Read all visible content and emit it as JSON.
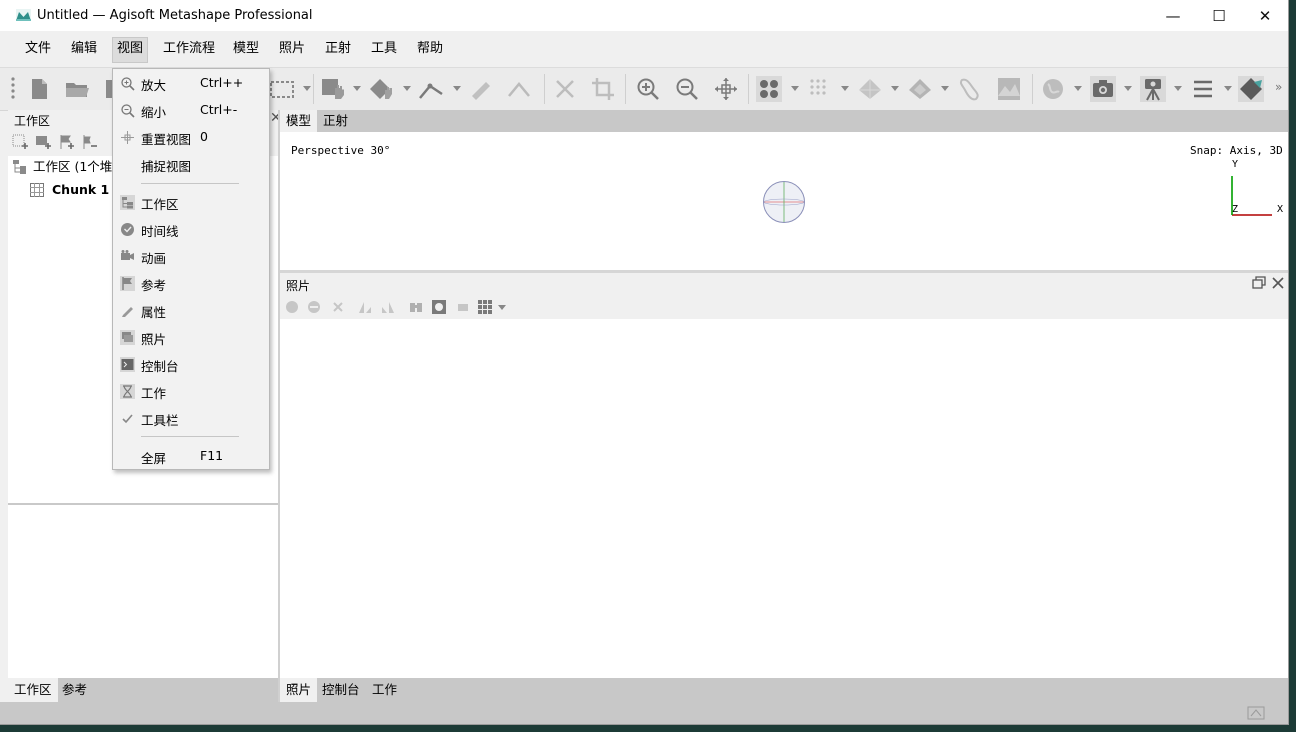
{
  "window": {
    "title": "Untitled — Agisoft Metashape Professional",
    "minimize_glyph": "—",
    "maximize_glyph": "☐",
    "close_glyph": "✕"
  },
  "menubar": {
    "items": [
      "文件",
      "编辑",
      "视图",
      "工作流程",
      "模型",
      "照片",
      "正射",
      "工具",
      "帮助"
    ],
    "active": "视图"
  },
  "view_menu": {
    "items": [
      {
        "label": "放大",
        "shortcut": "Ctrl++",
        "icon": "zoom-in-icon"
      },
      {
        "label": "缩小",
        "shortcut": "Ctrl+-",
        "icon": "zoom-out-icon"
      },
      {
        "label": "重置视图",
        "shortcut": "0",
        "icon": "reset-view-icon"
      },
      {
        "label": "捕捉视图",
        "shortcut": "",
        "icon": ""
      },
      {
        "label": "工作区",
        "shortcut": "",
        "icon": "workspace-icon"
      },
      {
        "label": "时间线",
        "shortcut": "",
        "icon": "timeline-icon"
      },
      {
        "label": "动画",
        "shortcut": "",
        "icon": "animation-icon"
      },
      {
        "label": "参考",
        "shortcut": "",
        "icon": "reference-icon"
      },
      {
        "label": "属性",
        "shortcut": "",
        "icon": "properties-icon"
      },
      {
        "label": "照片",
        "shortcut": "",
        "icon": "photos-icon"
      },
      {
        "label": "控制台",
        "shortcut": "",
        "icon": "console-icon"
      },
      {
        "label": "工作",
        "shortcut": "",
        "icon": "jobs-icon"
      },
      {
        "label": "工具栏",
        "shortcut": "",
        "icon": "check-icon",
        "checked": true
      },
      {
        "label": "全屏",
        "shortcut": "F11",
        "icon": ""
      }
    ]
  },
  "workspace_panel": {
    "title": "工作区",
    "root_label": "工作区 (1个堆块",
    "chunk_label": "Chunk 1",
    "bottom_tabs": [
      "工作区",
      "参考"
    ]
  },
  "model_view": {
    "tabs": [
      "模型",
      "正射"
    ],
    "projection_text": "Perspective 30°",
    "snap_text": "Snap: Axis, 3D",
    "axis_y": "Y",
    "axis_x": "X",
    "axis_z": "Z"
  },
  "photos_panel": {
    "title": "照片"
  },
  "bottom_tabs": [
    "照片",
    "控制台",
    "工作"
  ],
  "colors": {
    "accent_bar": "#4aa3a0",
    "axis_x": "#b00000",
    "axis_y": "#00a000",
    "menu_bg": "#f2f2f2"
  }
}
